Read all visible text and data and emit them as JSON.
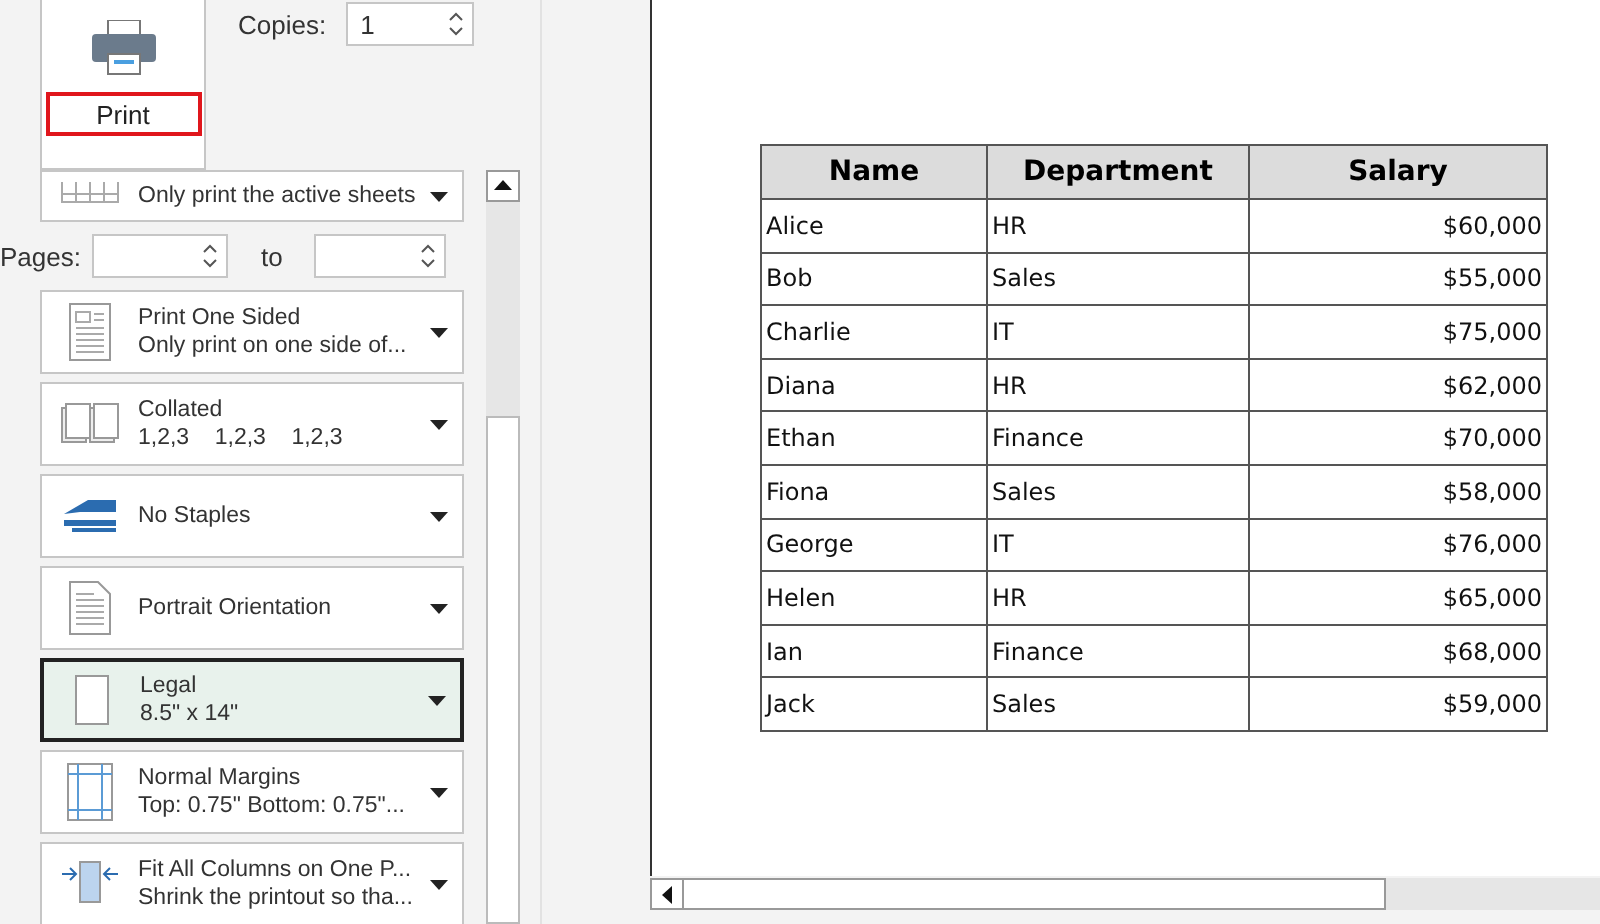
{
  "print_button": {
    "label": "Print"
  },
  "copies": {
    "label": "Copies:",
    "value": "1"
  },
  "settings": [
    {
      "subtitle": "Only print the active sheets",
      "selected": false
    },
    {
      "title": "Print One Sided",
      "subtitle": "Only print on one side of...",
      "selected": false
    },
    {
      "title": "Collated",
      "subtitle": "1,2,3    1,2,3    1,2,3",
      "selected": false
    },
    {
      "title": "No Staples",
      "selected": false
    },
    {
      "title": "Portrait Orientation",
      "selected": false
    },
    {
      "title": "Legal",
      "subtitle": "8.5\" x 14\"",
      "selected": true
    },
    {
      "title": "Normal Margins",
      "subtitle": "Top: 0.75\" Bottom: 0.75\"...",
      "selected": false
    },
    {
      "title": "Fit All Columns on One P...",
      "subtitle": "Shrink the printout so tha...",
      "selected": false
    }
  ],
  "pages": {
    "label": "Pages:",
    "to": "to"
  },
  "preview_table": {
    "columns": [
      "Name",
      "Department",
      "Salary"
    ],
    "rows": [
      [
        "Alice",
        "HR",
        "$60,000"
      ],
      [
        "Bob",
        "Sales",
        "$55,000"
      ],
      [
        "Charlie",
        "IT",
        "$75,000"
      ],
      [
        "Diana",
        "HR",
        "$62,000"
      ],
      [
        "Ethan",
        "Finance",
        "$70,000"
      ],
      [
        "Fiona",
        "Sales",
        "$58,000"
      ],
      [
        "George",
        "IT",
        "$76,000"
      ],
      [
        "Helen",
        "HR",
        "$65,000"
      ],
      [
        "Ian",
        "Finance",
        "$68,000"
      ],
      [
        "Jack",
        "Sales",
        "$59,000"
      ]
    ]
  }
}
